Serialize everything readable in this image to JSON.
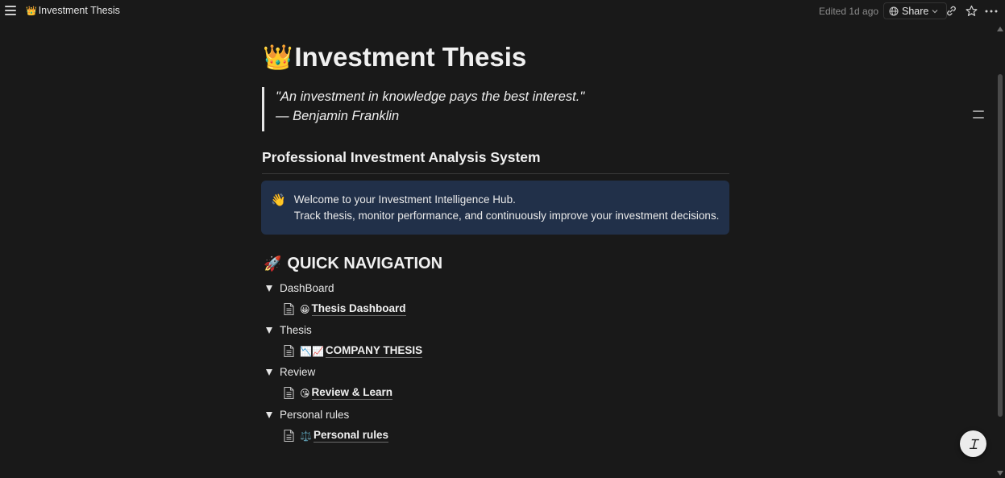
{
  "topbar": {
    "breadcrumb_emoji": "👑",
    "breadcrumb_title": "Investment Thesis",
    "edited": "Edited 1d ago",
    "share_label": "Share"
  },
  "page": {
    "title_emoji": "👑",
    "title": "Investment Thesis",
    "quote_line1": "\"An investment in knowledge pays the best interest.\"",
    "quote_line2": "— Benjamin Franklin",
    "subtitle": "Professional Investment Analysis System",
    "callout_emoji": "👋",
    "callout_line1": "Welcome to your Investment Intelligence Hub.",
    "callout_line2": "Track thesis, monitor performance, and continuously improve your investment decisions.",
    "nav_emoji": "🚀",
    "nav_heading": "QUICK NAVIGATION"
  },
  "navigation": [
    {
      "toggle": "DashBoard",
      "page_emoji": "😀",
      "page_label": "Thesis Dashboard"
    },
    {
      "toggle": "Thesis",
      "page_emoji": "📉📈",
      "page_label": "COMPANY THESIS"
    },
    {
      "toggle": "Review",
      "page_emoji": "😘",
      "page_label": "Review & Learn"
    },
    {
      "toggle": "Personal rules",
      "page_emoji": "⚖️",
      "page_label": "Personal rules"
    }
  ],
  "help_glyph": "Ɪ",
  "colors": {
    "background": "#191919",
    "callout_bg": "#213049",
    "text": "#e6e6e6",
    "muted": "#8c8c8c"
  }
}
